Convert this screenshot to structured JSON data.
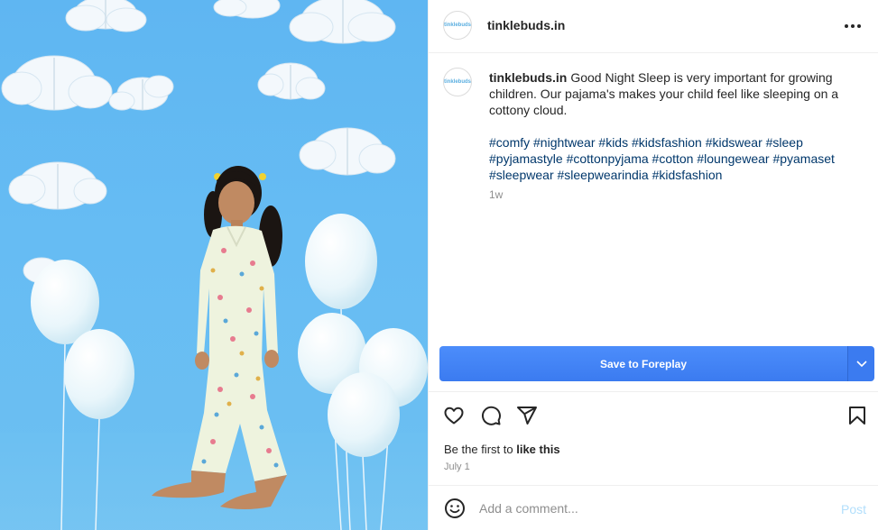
{
  "post": {
    "username": "tinklebuds.in",
    "avatar_text": "tinklebuds",
    "caption": "Good Night Sleep is very important for growing children. Our pajama's makes your child feel like sleeping on a cottony cloud.",
    "hashtags": [
      "#comfy",
      "#nightwear",
      "#kids",
      "#kidsfashion",
      "#kidswear",
      "#sleep",
      "#pyjamastyle",
      "#cottonpyjama",
      "#cotton",
      "#loungewear",
      "#pyamaset",
      "#sleepwear",
      "#sleepwearindia",
      "#kidsfashion"
    ],
    "age": "1w",
    "likes_prefix": "Be the first to",
    "likes_action": "like this",
    "date": "July 1"
  },
  "save": {
    "label": "Save to Foreplay"
  },
  "comment": {
    "placeholder": "Add a comment...",
    "post_label": "Post"
  },
  "icons": {
    "more": "more-horizontal-icon",
    "like": "heart-icon",
    "comment": "comment-bubble-icon",
    "share": "paper-plane-icon",
    "save": "bookmark-icon",
    "emoji": "smiley-icon",
    "dropdown": "chevron-down-icon"
  },
  "colors": {
    "save_button": "#3b7bf0",
    "hashtag": "#00376b",
    "photo_background": "#66bcf3",
    "post_disabled": "#b2dffc"
  }
}
